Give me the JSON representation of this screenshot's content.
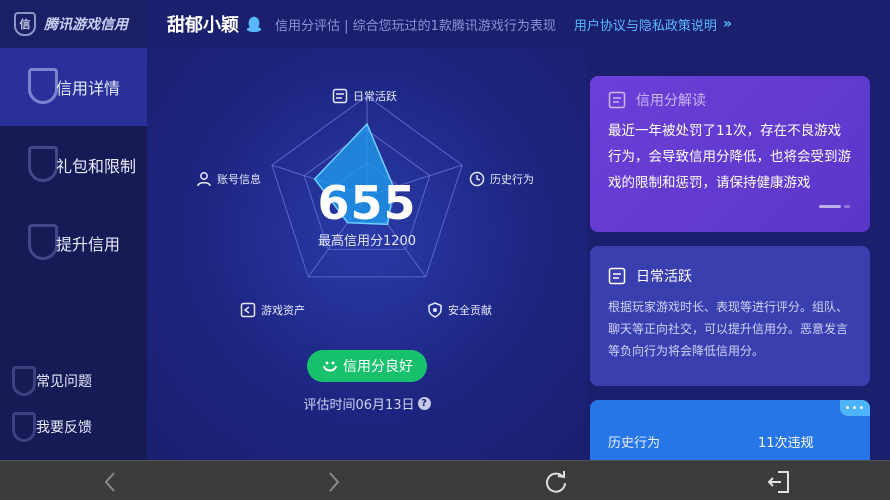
{
  "brand": {
    "name": "腾讯游戏信用",
    "logo_text": "信"
  },
  "sidebar": {
    "items": [
      {
        "label": "信用详情",
        "active": true
      },
      {
        "label": "礼包和限制",
        "active": false
      },
      {
        "label": "提升信用",
        "active": false
      }
    ],
    "footer_items": [
      {
        "label": "常见问题"
      },
      {
        "label": "我要反馈"
      }
    ]
  },
  "header": {
    "username": "甜郁小颖",
    "description": "信用分评估 | 综合您玩过的1款腾讯游戏行为表现",
    "policy_link": "用户协议与隐私政策说明",
    "policy_chevron": "»"
  },
  "radar": {
    "dimensions": [
      {
        "label": "日常活跃",
        "icon": "document-icon",
        "value": 0.72
      },
      {
        "label": "历史行为",
        "icon": "clock-icon",
        "value": 0.28
      },
      {
        "label": "安全贡献",
        "icon": "shield-icon",
        "value": 0.35
      },
      {
        "label": "游戏资产",
        "icon": "asset-icon",
        "value": 0.33
      },
      {
        "label": "账号信息",
        "icon": "user-icon",
        "value": 0.55
      }
    ],
    "score": "655",
    "score_caption": "最高信用分1200",
    "status": "信用分良好",
    "eval_time": "评估时间06月13日",
    "help_glyph": "?",
    "colors": {
      "fill": "#1ea0f0",
      "grid": "#5a66c8"
    }
  },
  "cards": {
    "interpret": {
      "title": "信用分解读",
      "body": "最近一年被处罚了11次，存在不良游戏行为，会导致信用分降低，也将会受到游戏的限制和惩罚，请保持健康游戏"
    },
    "daily": {
      "title": "日常活跃",
      "body": "根据玩家游戏时长、表现等进行评分。组队、聊天等正向社交，可以提升信用分。恶意发言等负向行为将会降低信用分。"
    },
    "history": {
      "label": "历史行为",
      "value": "11次违规",
      "corner": "•••"
    }
  },
  "colors": {
    "background": "#1a1f6e",
    "sidebar": "#161a55",
    "sidebar_active": "#2a309a",
    "status_green": "#18c26d",
    "card1": "#6c3fd8",
    "card2": "#3a3fb0",
    "card3": "#2776e8",
    "link": "#5ab8ff"
  },
  "bottom_bar": {
    "buttons": [
      "back-icon",
      "forward-icon",
      "refresh-icon",
      "exit-icon"
    ]
  }
}
